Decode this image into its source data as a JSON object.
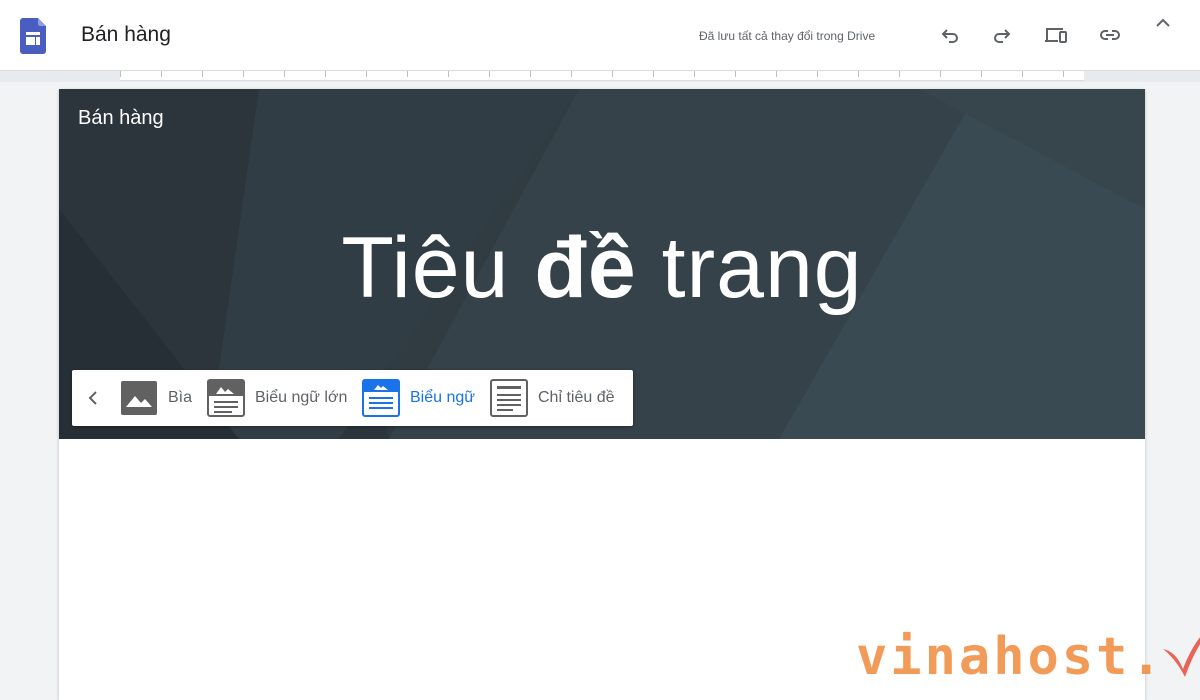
{
  "app": {
    "doc_title": "Bán hàng",
    "save_status": "Đã lưu tất cả thay đổi trong Drive",
    "toolbar": {
      "undo_icon": "undo-icon",
      "redo_icon": "redo-icon",
      "preview_icon": "device-preview-icon",
      "link_icon": "link-icon",
      "more_icon": "chevron-up-icon"
    }
  },
  "page": {
    "site_name": "Bán hàng",
    "title_part1": "Tiêu ",
    "title_bold": "đề",
    "title_part2": " trang"
  },
  "header_picker": {
    "back_icon": "chevron-left-icon",
    "options": [
      {
        "label": "Bìa",
        "icon": "cover-image-icon",
        "selected": false
      },
      {
        "label": "Biểu ngữ lớn",
        "icon": "large-banner-icon",
        "selected": false
      },
      {
        "label": "Biểu ngữ",
        "icon": "banner-icon",
        "selected": true
      },
      {
        "label": "Chỉ tiêu đề",
        "icon": "title-only-icon",
        "selected": false
      }
    ]
  },
  "watermark": {
    "text": "vinahost."
  },
  "colors": {
    "accent": "#1a73e8",
    "banner_bg": "#2f3b42",
    "icon_gray": "#616161",
    "logo_blue": "#4a5ec2",
    "watermark_orange": "#f08a3c",
    "watermark_red": "#e84a3a"
  }
}
